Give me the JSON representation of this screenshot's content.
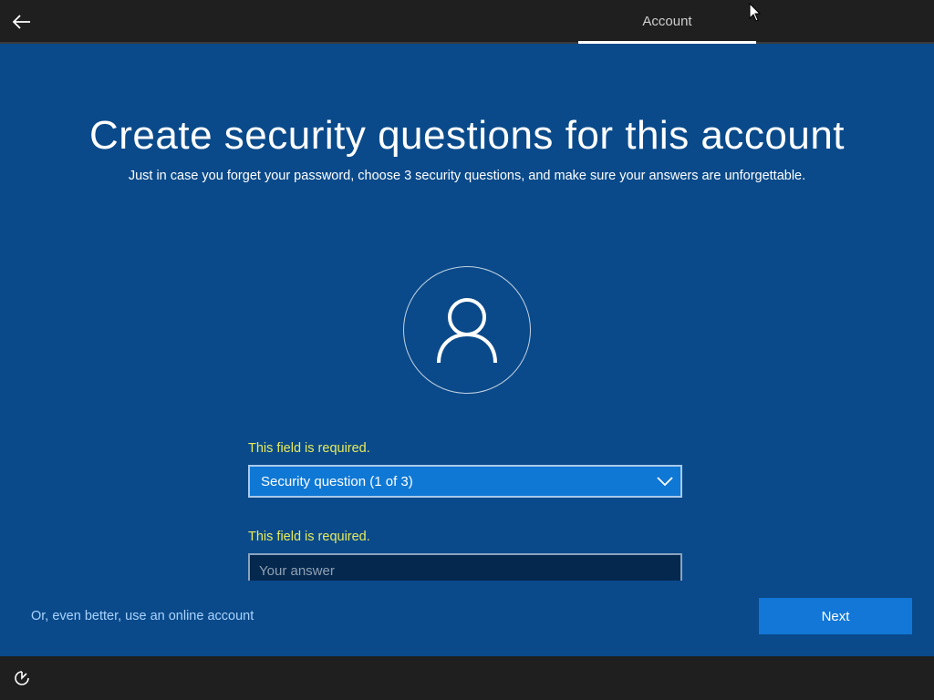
{
  "header": {
    "tab_label": "Account",
    "back_icon": "arrow-left-icon"
  },
  "main": {
    "title": "Create security questions for this account",
    "subtitle": "Just in case you forget your password, choose 3 security questions, and make sure your answers are unforgettable.",
    "avatar_icon": "user-icon",
    "question_error": "This field is required.",
    "question_dropdown": {
      "selected": "Security question (1 of 3)",
      "icon": "chevron-down-icon"
    },
    "answer_error": "This field is required.",
    "answer_placeholder": "Your answer"
  },
  "footer_actions": {
    "online_account_link": "Or, even better, use an online account",
    "next_button": "Next"
  },
  "footer": {
    "ease_of_access_icon": "ease-of-access-icon"
  },
  "colors": {
    "background": "#0a4a8a",
    "error_text": "#e6ea5c",
    "dropdown_accent": "#0f78d4",
    "button": "#1277d6",
    "link": "#a9d3ff",
    "bar": "#1f1f1f"
  }
}
